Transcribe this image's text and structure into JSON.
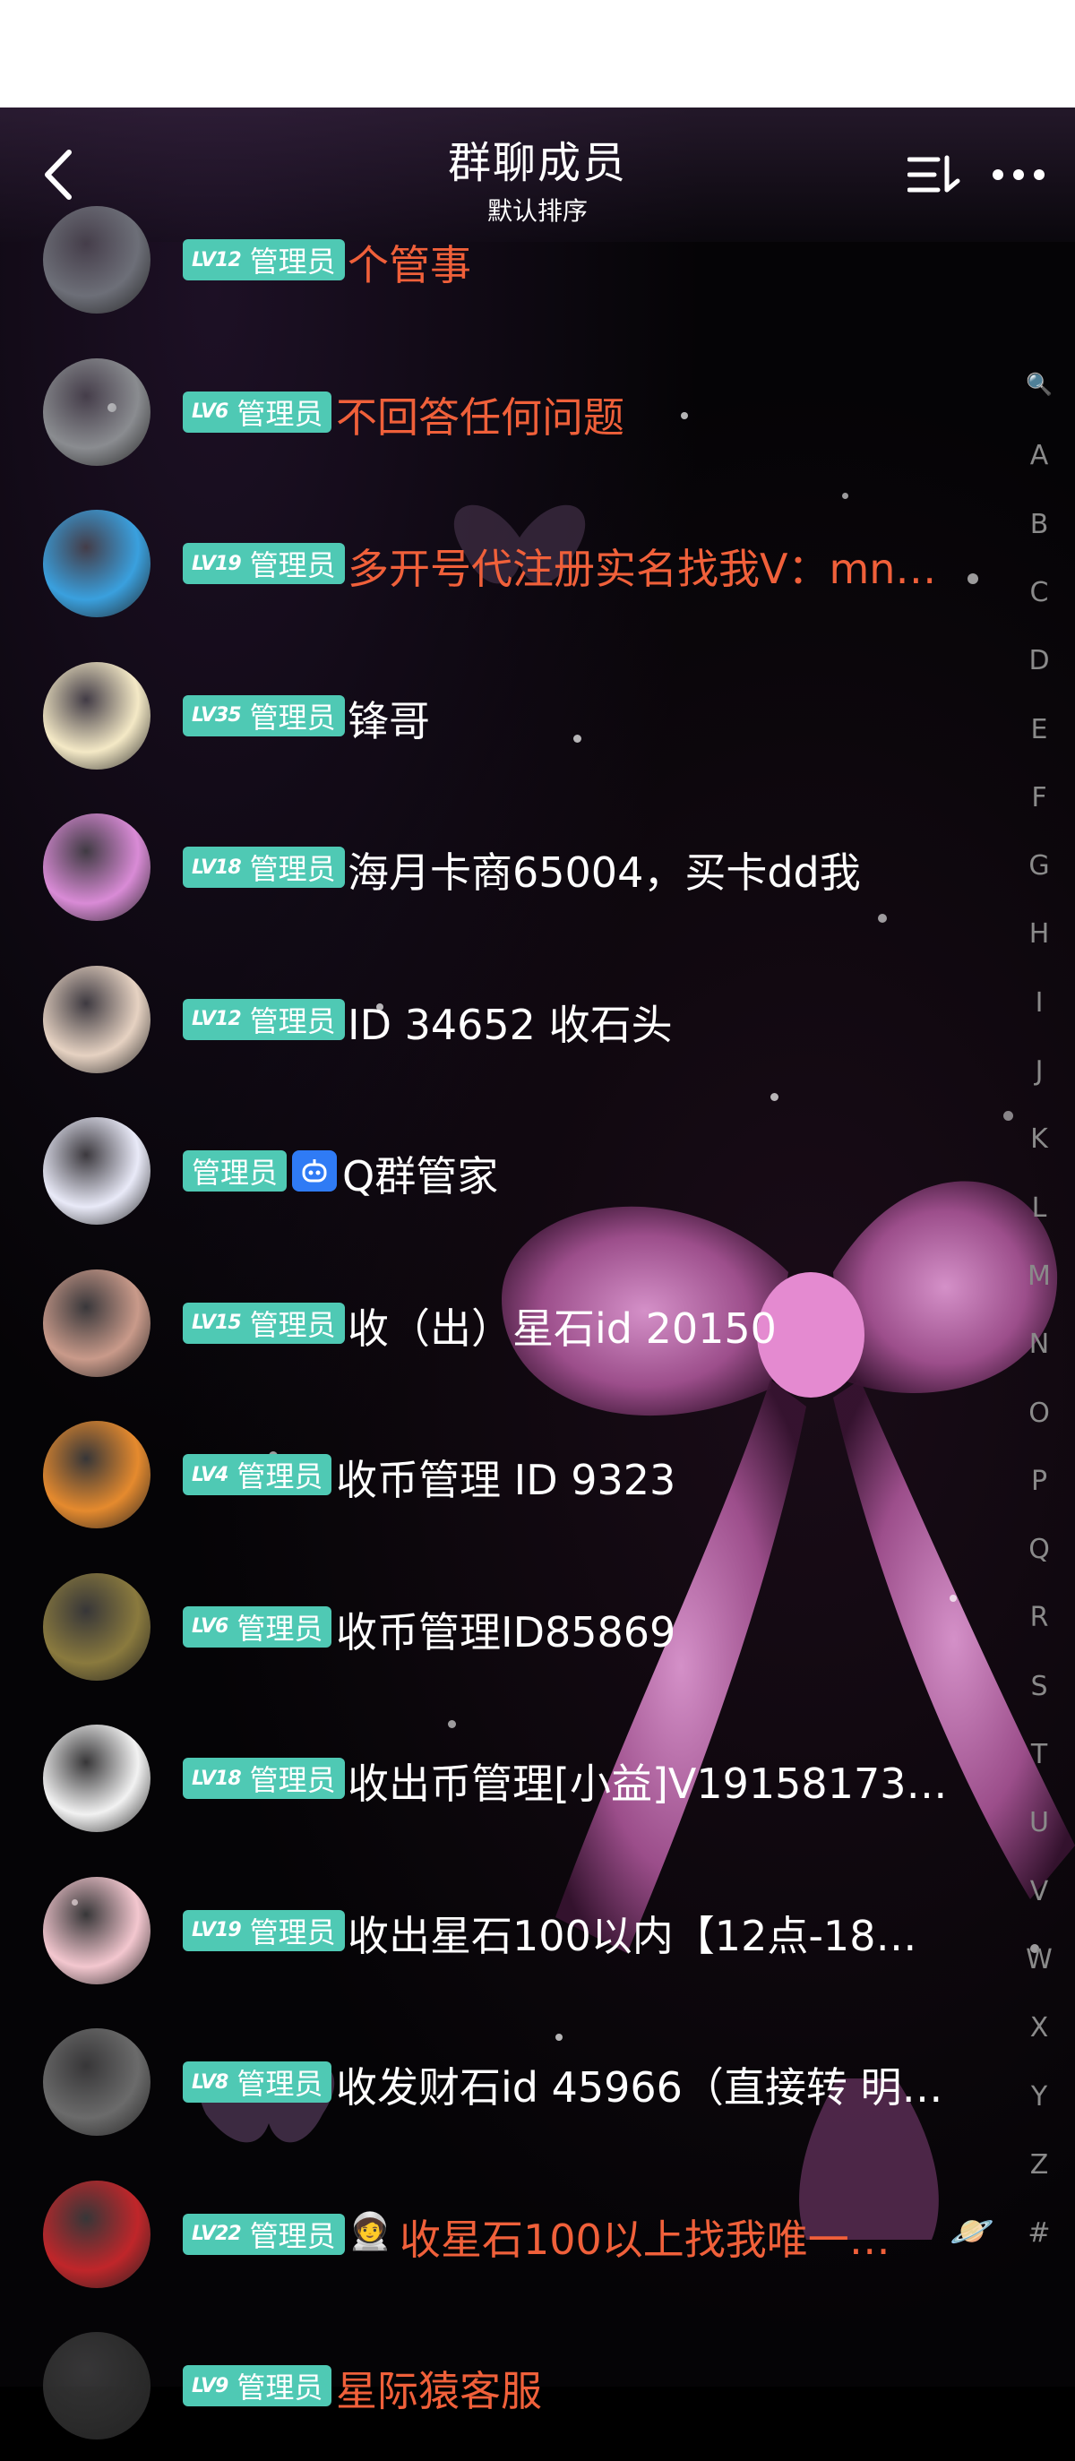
{
  "header": {
    "title": "群聊成员",
    "subtitle": "默认排序",
    "icons": [
      "back-icon",
      "sort-list-icon",
      "more-icon"
    ]
  },
  "members": [
    {
      "level": "LV12",
      "role": "管理员",
      "name": "个管事",
      "name_color": "#f0603a",
      "avatar_color": "#6d6f78"
    },
    {
      "level": "LV6",
      "role": "管理员",
      "name": "不回答任何问题",
      "name_color": "#f0603a",
      "avatar_color": "#8a8c90"
    },
    {
      "level": "LV19",
      "role": "管理员",
      "name": "多开号代注册实名找我V：mn…",
      "name_color": "#f0603a",
      "avatar_color": "#3aa0de"
    },
    {
      "level": "LV35",
      "role": "管理员",
      "name": "锋哥",
      "name_color": "#ffffff",
      "avatar_color": "#f4e9c6"
    },
    {
      "level": "LV18",
      "role": "管理员",
      "name": "海月卡商65004，买卡dd我",
      "name_color": "#ffffff",
      "avatar_color": "#d98bd6"
    },
    {
      "level": "LV12",
      "role": "管理员",
      "name": "ID  34652 收石头",
      "name_color": "#ffffff",
      "avatar_color": "#e6d2c2"
    },
    {
      "level": "",
      "role": "管理员",
      "name": "Q群管家",
      "name_color": "#ffffff",
      "avatar_color": "#e9eaf8",
      "bot": true
    },
    {
      "level": "LV15",
      "role": "管理员",
      "name": "收（出）星石id 20150",
      "name_color": "#ffffff",
      "avatar_color": "#c99a8a"
    },
    {
      "level": "LV4",
      "role": "管理员",
      "name": "收币管理 ID 9323",
      "name_color": "#ffffff",
      "avatar_color": "#e58a2e"
    },
    {
      "level": "LV6",
      "role": "管理员",
      "name": "收币管理ID85869",
      "name_color": "#ffffff",
      "avatar_color": "#8a7a3e"
    },
    {
      "level": "LV18",
      "role": "管理员",
      "name": "收出币管理[小益]V19158173…",
      "name_color": "#ffffff",
      "avatar_color": "#f2f2f2"
    },
    {
      "level": "LV19",
      "role": "管理员",
      "name": "收出星石100以内【12点-18…",
      "name_color": "#ffffff",
      "avatar_color": "#f3c7cf"
    },
    {
      "level": "LV8",
      "role": "管理员",
      "name": "收发财石id 45966（直接转 明…",
      "name_color": "#ffffff",
      "avatar_color": "#6b6b6b"
    },
    {
      "level": "LV22",
      "role": "管理员",
      "name": "收星石100以上找我唯一…",
      "name_color": "#f0603a",
      "avatar_color": "#c0262a",
      "prefix_emoji": "🧑‍🚀",
      "suffix_emoji": "🪐"
    },
    {
      "level": "LV9",
      "role": "管理员",
      "name": "星际猿客服",
      "name_color": "#f0603a",
      "avatar_color": "#2b2b2b"
    }
  ],
  "index_letters": [
    "🔍",
    "A",
    "B",
    "C",
    "D",
    "E",
    "F",
    "G",
    "H",
    "I",
    "J",
    "K",
    "L",
    "M",
    "N",
    "O",
    "P",
    "Q",
    "R",
    "S",
    "T",
    "U",
    "V",
    "W",
    "X",
    "Y",
    "Z",
    "#"
  ]
}
